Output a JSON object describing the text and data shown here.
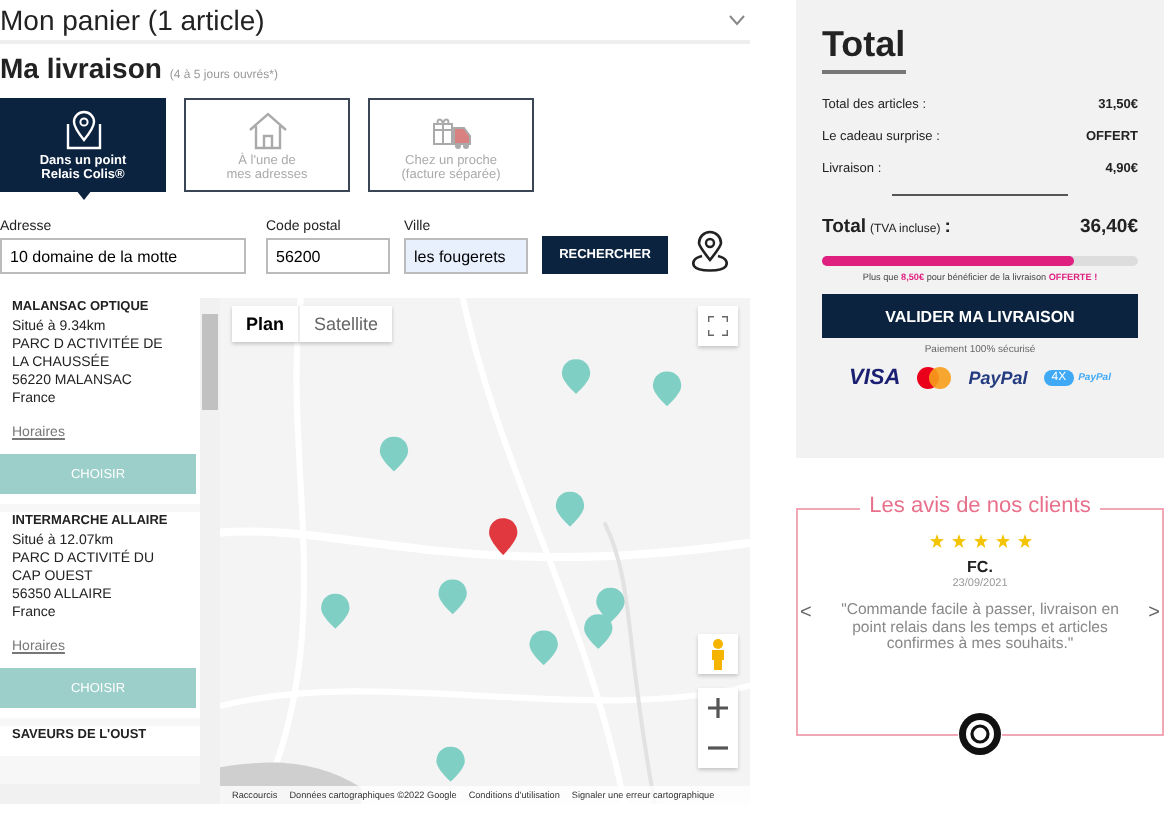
{
  "cart_header": {
    "title": "Mon panier (1 article)",
    "expanded": false
  },
  "delivery": {
    "title": "Ma livraison",
    "note": "(4 à 5 jours ouvrés*)"
  },
  "options": [
    {
      "kind": "relay",
      "lines": [
        "Dans un point",
        "Relais Colis®"
      ],
      "selected": true
    },
    {
      "kind": "home",
      "lines": [
        "À l'une de",
        "mes adresses"
      ],
      "selected": false
    },
    {
      "kind": "relative",
      "lines": [
        "Chez un proche",
        "(facture séparée)"
      ],
      "selected": false
    }
  ],
  "form": {
    "fields": [
      {
        "label": "Adresse",
        "value": "10 domaine de la motte",
        "highlighted": false
      },
      {
        "label": "Code postal",
        "value": "56200",
        "highlighted": false
      },
      {
        "label": "Ville",
        "value": "les fougerets",
        "highlighted": true
      }
    ],
    "button": "RECHERCHER"
  },
  "relays": [
    {
      "name": "MALANSAC OPTIQUE",
      "distance": "Situé à 9.34km",
      "address": [
        "PARC D ACTIVITÉE DE",
        "LA CHAUSSÉE",
        "56220 MALANSAC",
        "France"
      ],
      "hours_link": "Horaires",
      "button": "CHOISIR"
    },
    {
      "name": "INTERMARCHE ALLAIRE",
      "distance": "Situé à 12.07km",
      "address": [
        "PARC D ACTIVITÉ DU",
        "CAP OUEST",
        "56350 ALLAIRE",
        "France"
      ],
      "hours_link": "Horaires",
      "button": "CHOISIR"
    },
    {
      "name": "SAVEURS DE L'OUST"
    }
  ],
  "map": {
    "types": [
      {
        "label": "Plan",
        "selected": true
      },
      {
        "label": "Satellite",
        "selected": false
      }
    ],
    "attribution": [
      "Raccourcis",
      "Données cartographiques ©2022 Google",
      "Conditions d'utilisation",
      "Signaler une erreur cartographique"
    ]
  },
  "summary": {
    "title": "Total",
    "lines": [
      {
        "label": "Total des articles :",
        "value": "31,50€"
      },
      {
        "label": "Le cadeau surprise :",
        "value": "OFFERT"
      },
      {
        "label": "Livraison :",
        "value": "4,90€"
      }
    ],
    "total": {
      "label": "Total",
      "note": "(TVA incluse)",
      "colon": ":",
      "value": "36,40€"
    },
    "free_shipping": {
      "level": 0.8,
      "message": "Plus que **8,50€** pour bénéficier de la livraison **OFFERTE !**"
    },
    "button": "VALIDER MA LIVRAISON",
    "secure_note": "Paiement 100% sécurisé",
    "payments": [
      {
        "kind": "visa",
        "text": "VISA"
      },
      {
        "kind": "mastercard"
      },
      {
        "kind": "paypal",
        "text": "PayPal"
      },
      {
        "kind": "installments",
        "text": "4X",
        "sub": "PayPal"
      }
    ]
  },
  "reviews": {
    "title": "Les avis de nos clients",
    "stars": 5,
    "author": "FC.",
    "date": "23/09/2021",
    "quote": "\"Commande facile à passer, livraison en point relais dans les temps et articles confirmes à mes souhaits.\"",
    "prev": "<",
    "next": ">"
  }
}
